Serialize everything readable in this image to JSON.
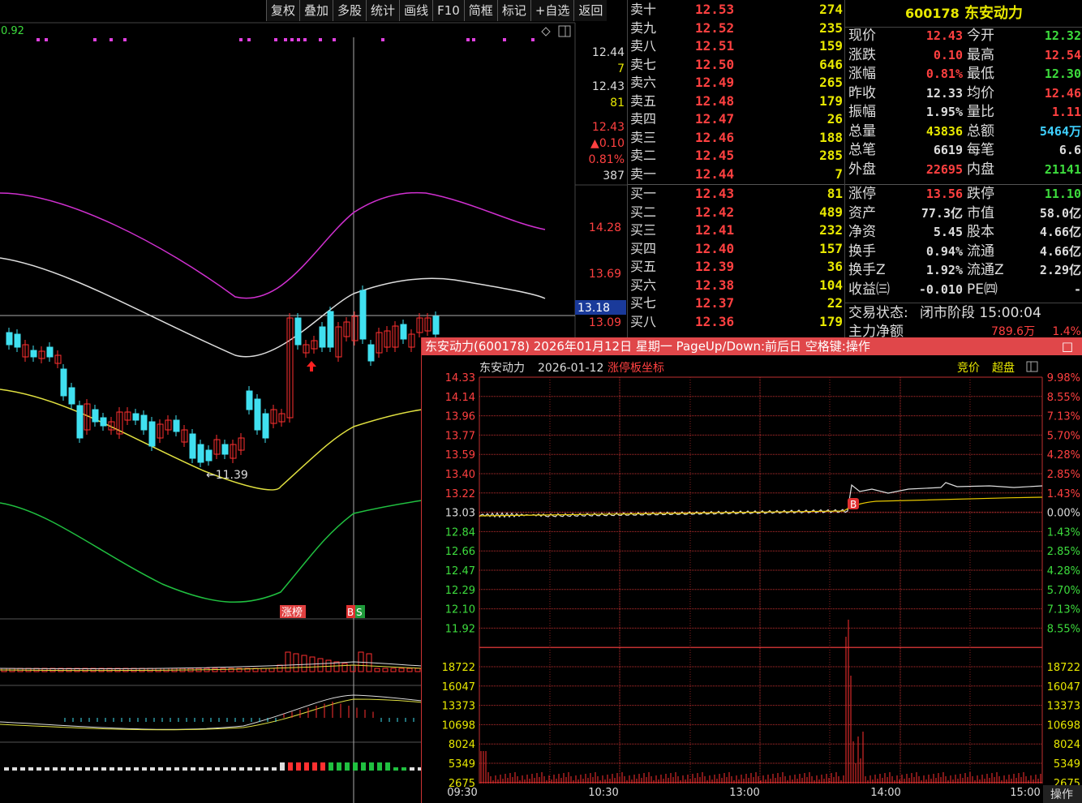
{
  "toolbar": {
    "buttons": [
      "复权",
      "叠加",
      "多股",
      "统计",
      "画线",
      "F10",
      "简框",
      "标记",
      "+自选",
      "返回"
    ]
  },
  "kline": {
    "corner_value": "0.92",
    "right_axis_top": [
      "12.44",
      "7",
      "12.43",
      "81",
      "12.43",
      "▲0.10",
      "0.81%",
      "387"
    ],
    "right_axis_prices": [
      "14.28",
      "13.69",
      "13.18",
      "13.09"
    ],
    "low_marker": "←11.39",
    "badge_zhangbang": "涨榜",
    "badge_b": "B",
    "badge_s": "S"
  },
  "orderbook": {
    "asks": [
      {
        "label": "卖十",
        "price": "12.53",
        "vol": "274"
      },
      {
        "label": "卖九",
        "price": "12.52",
        "vol": "235"
      },
      {
        "label": "卖八",
        "price": "12.51",
        "vol": "159"
      },
      {
        "label": "卖七",
        "price": "12.50",
        "vol": "646"
      },
      {
        "label": "卖六",
        "price": "12.49",
        "vol": "265"
      },
      {
        "label": "卖五",
        "price": "12.48",
        "vol": "179"
      },
      {
        "label": "卖四",
        "price": "12.47",
        "vol": "26"
      },
      {
        "label": "卖三",
        "price": "12.46",
        "vol": "188"
      },
      {
        "label": "卖二",
        "price": "12.45",
        "vol": "285"
      },
      {
        "label": "卖一",
        "price": "12.44",
        "vol": "7"
      }
    ],
    "bids": [
      {
        "label": "买一",
        "price": "12.43",
        "vol": "81"
      },
      {
        "label": "买二",
        "price": "12.42",
        "vol": "489"
      },
      {
        "label": "买三",
        "price": "12.41",
        "vol": "232"
      },
      {
        "label": "买四",
        "price": "12.40",
        "vol": "157"
      },
      {
        "label": "买五",
        "price": "12.39",
        "vol": "36"
      },
      {
        "label": "买六",
        "price": "12.38",
        "vol": "104"
      },
      {
        "label": "买七",
        "price": "12.37",
        "vol": "22"
      },
      {
        "label": "买八",
        "price": "12.36",
        "vol": "179"
      }
    ]
  },
  "quote": {
    "code": "600178",
    "name": "东安动力",
    "rows": [
      {
        "l1": "现价",
        "v1": "12.43",
        "c1": "#ff4040",
        "l2": "今开",
        "v2": "12.32",
        "c2": "#3ddc3d"
      },
      {
        "l1": "涨跌",
        "v1": "0.10",
        "c1": "#ff4040",
        "l2": "最高",
        "v2": "12.54",
        "c2": "#ff4040"
      },
      {
        "l1": "涨幅",
        "v1": "0.81%",
        "c1": "#ff4040",
        "l2": "最低",
        "v2": "12.30",
        "c2": "#3ddc3d"
      },
      {
        "l1": "昨收",
        "v1": "12.33",
        "c1": "#dddddd",
        "l2": "均价",
        "v2": "12.46",
        "c2": "#ff4040"
      },
      {
        "l1": "振幅",
        "v1": "1.95%",
        "c1": "#dddddd",
        "l2": "量比",
        "v2": "1.11",
        "c2": "#ff4040"
      },
      {
        "l1": "总量",
        "v1": "43836",
        "c1": "#e8e800",
        "l2": "总额",
        "v2": "5464万",
        "c2": "#3fd0ff"
      },
      {
        "l1": "总笔",
        "v1": "6619",
        "c1": "#dddddd",
        "l2": "每笔",
        "v2": "6.6",
        "c2": "#dddddd"
      },
      {
        "l1": "外盘",
        "v1": "22695",
        "c1": "#ff4040",
        "l2": "内盘",
        "v2": "21141",
        "c2": "#3ddc3d"
      },
      {
        "l1": "涨停",
        "v1": "13.56",
        "c1": "#ff4040",
        "l2": "跌停",
        "v2": "11.10",
        "c2": "#3ddc3d"
      },
      {
        "l1": "资产",
        "v1": "77.3亿",
        "c1": "#dddddd",
        "l2": "市值",
        "v2": "58.0亿",
        "c2": "#dddddd"
      },
      {
        "l1": "净资",
        "v1": "5.45",
        "c1": "#dddddd",
        "l2": "股本",
        "v2": "4.66亿",
        "c2": "#dddddd"
      },
      {
        "l1": "换手",
        "v1": "0.94%",
        "c1": "#dddddd",
        "l2": "流通",
        "v2": "4.66亿",
        "c2": "#dddddd"
      },
      {
        "l1": "换手Z",
        "v1": "1.92%",
        "c1": "#dddddd",
        "l2": "流通Z",
        "v2": "2.29亿",
        "c2": "#dddddd"
      },
      {
        "l1": "收益㈢",
        "v1": "-0.010",
        "c1": "#dddddd",
        "l2": "PE㈣",
        "v2": "-",
        "c2": "#dddddd"
      }
    ],
    "status_label": "交易状态:",
    "status_value": "闭市阶段 15:00:04",
    "main_flow_label": "主力净额",
    "main_flow_value": "789.6万",
    "main_flow_pct": "1.4%"
  },
  "popup": {
    "title": "东安动力(600178) 2026年01月12日 星期一 PageUp/Down:前后日 空格键:操作",
    "close": "□",
    "subtitle_name": "东安动力",
    "subtitle_date": "2026-01-12",
    "subtitle_mode": "涨停板坐标",
    "btn_bid": "竞价",
    "btn_super": "超盘",
    "price_ticks": [
      "14.33",
      "14.14",
      "13.96",
      "13.77",
      "13.59",
      "13.40",
      "13.22",
      "13.03",
      "12.84",
      "12.66",
      "12.47",
      "12.29",
      "12.10",
      "11.92"
    ],
    "pct_ticks": [
      "9.98%",
      "8.55%",
      "7.13%",
      "5.70%",
      "4.28%",
      "2.85%",
      "1.43%",
      "0.00%",
      "1.43%",
      "2.85%",
      "4.28%",
      "5.70%",
      "7.13%",
      "8.55%"
    ],
    "vol_ticks": [
      "18722",
      "16047",
      "13373",
      "10698",
      "8024",
      "5349",
      "2675"
    ],
    "time_ticks": [
      "09:30",
      "10:30",
      "13:00",
      "14:00",
      "15:00"
    ],
    "b_marker": "B",
    "op_button": "操作"
  }
}
